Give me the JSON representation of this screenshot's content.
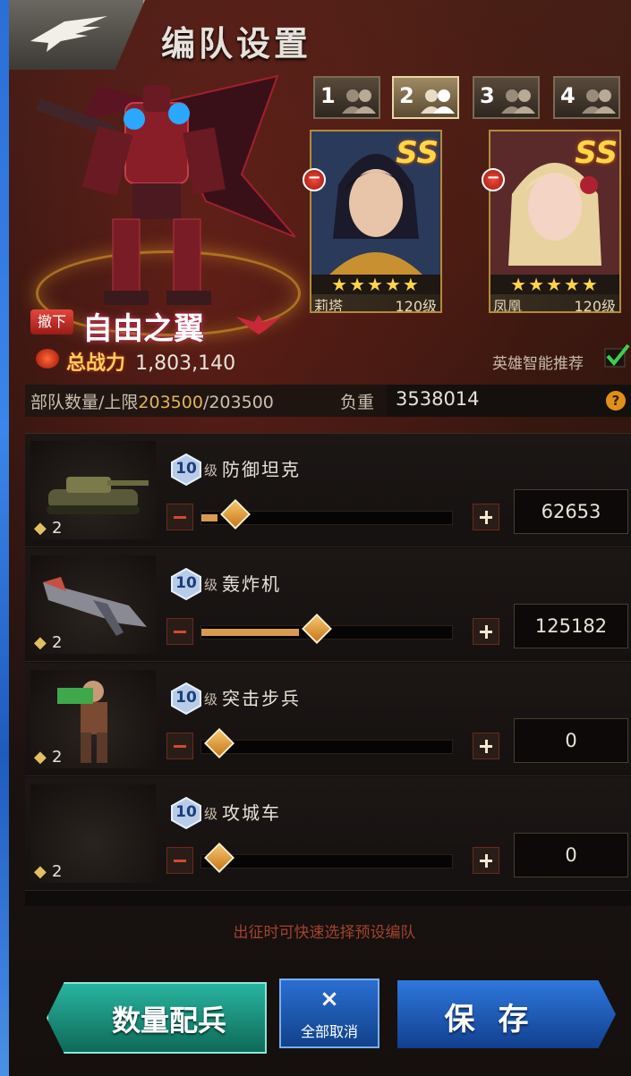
{
  "header": {
    "title": "编队设置",
    "back_icon": "eagle-wing-icon"
  },
  "unit": {
    "withdraw_label": "撤下",
    "name": "自由之翼",
    "power_label": "总战力",
    "power_value": "1,803,140"
  },
  "teams": [
    {
      "number": "1",
      "active": false
    },
    {
      "number": "2",
      "active": true
    },
    {
      "number": "3",
      "active": false
    },
    {
      "number": "4",
      "active": false
    }
  ],
  "heroes": [
    {
      "name": "莉塔",
      "level": "120级",
      "grade": "SS",
      "stars": "★★★★★"
    },
    {
      "name": "凤凰",
      "level": "120级",
      "grade": "SS",
      "stars": "★★★★★"
    }
  ],
  "recommend_label": "英雄智能推荐",
  "capacity": {
    "troop_label": "部队数量/上限",
    "troop_current": "203500",
    "troop_max": "/203500",
    "load_label": "负重",
    "load_value": "3538014",
    "help_icon": "?"
  },
  "troops": [
    {
      "level": "10",
      "level_unit": "级",
      "name": "防御坦克",
      "stack": "2",
      "count": "62653",
      "fraction": 0.065
    },
    {
      "level": "10",
      "level_unit": "级",
      "name": "轰炸机",
      "stack": "2",
      "count": "125182",
      "fraction": 0.39
    },
    {
      "level": "10",
      "level_unit": "级",
      "name": "突击步兵",
      "stack": "2",
      "count": "0",
      "fraction": 0
    },
    {
      "level": "10",
      "level_unit": "级",
      "name": "攻城车",
      "stack": "2",
      "count": "0",
      "fraction": 0
    }
  ],
  "hint": "出征时可快速选择预设编队",
  "buttons": {
    "auto_assign": "数量配兵",
    "cancel_all_icon": "×",
    "cancel_all": "全部取消",
    "save": "保存"
  },
  "colors": {
    "accent_gold": "#e2b458",
    "auto_button": "#28b4a0",
    "save_button": "#2e78dc",
    "slider_fill": "#d99a4c"
  }
}
